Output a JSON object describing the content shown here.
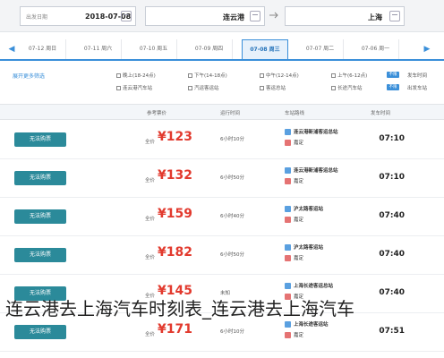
{
  "search": {
    "date_label": "出发日期",
    "date_value": "2018-07-08",
    "from_value": "连云港",
    "to_value": "上海",
    "swap_label": "→"
  },
  "date_tabs": [
    "07-12 周日",
    "07-11 周六",
    "07-10 周五",
    "07-09 周四",
    "07-08 周三",
    "07-07 周二",
    "07-06 周一"
  ],
  "active_tab": 4,
  "filters": {
    "expand_link": "展开更多筛选",
    "depart_time_label": "发车时间",
    "station_label": "出发车站",
    "all_label": "不限",
    "time_options": [
      "上午(6-12点)",
      "中午(12-14点)",
      "下午(14-18点)",
      "晚上(18-24点)"
    ],
    "station_options": [
      "长途汽车站",
      "客运总站",
      "汽运客运站",
      "连云港汽车站"
    ]
  },
  "table": {
    "headers": [
      "发车时间",
      "车站路线",
      "运行时间",
      "参考票价",
      ""
    ],
    "rows": [
      {
        "time": "07:10",
        "start": "连云港新浦客运总站",
        "end": "嘉定",
        "duration": "6小时10分",
        "price_pre": "全价",
        "price": "¥123",
        "button": "无法购票"
      },
      {
        "time": "07:10",
        "start": "连云港新浦客运总站",
        "end": "嘉定",
        "duration": "6小时50分",
        "price_pre": "全价",
        "price": "¥132",
        "button": "无法购票"
      },
      {
        "time": "07:40",
        "start": "沪太路客运站",
        "end": "嘉定",
        "duration": "6小时40分",
        "price_pre": "全价",
        "price": "¥159",
        "button": "无法购票"
      },
      {
        "time": "07:40",
        "start": "沪太路客运站",
        "end": "嘉定",
        "duration": "6小时50分",
        "price_pre": "全价",
        "price": "¥182",
        "button": "无法购票"
      },
      {
        "time": "07:40",
        "start": "上海长途客运总站",
        "end": "嘉定",
        "duration": "未知",
        "price_pre": "全价",
        "price": "¥145",
        "button": "无法购票"
      },
      {
        "time": "07:51",
        "start": "上海长途客运站",
        "end": "嘉定",
        "duration": "6小时10分",
        "price_pre": "全价",
        "price": "¥171",
        "button": "无法购票"
      }
    ]
  },
  "caption": "连云港去上海汽车时刻表_连云港去上海汽车",
  "colors": {
    "accent": "#3a8fd9",
    "price": "#e23a2e",
    "button": "#2b8a9a"
  }
}
